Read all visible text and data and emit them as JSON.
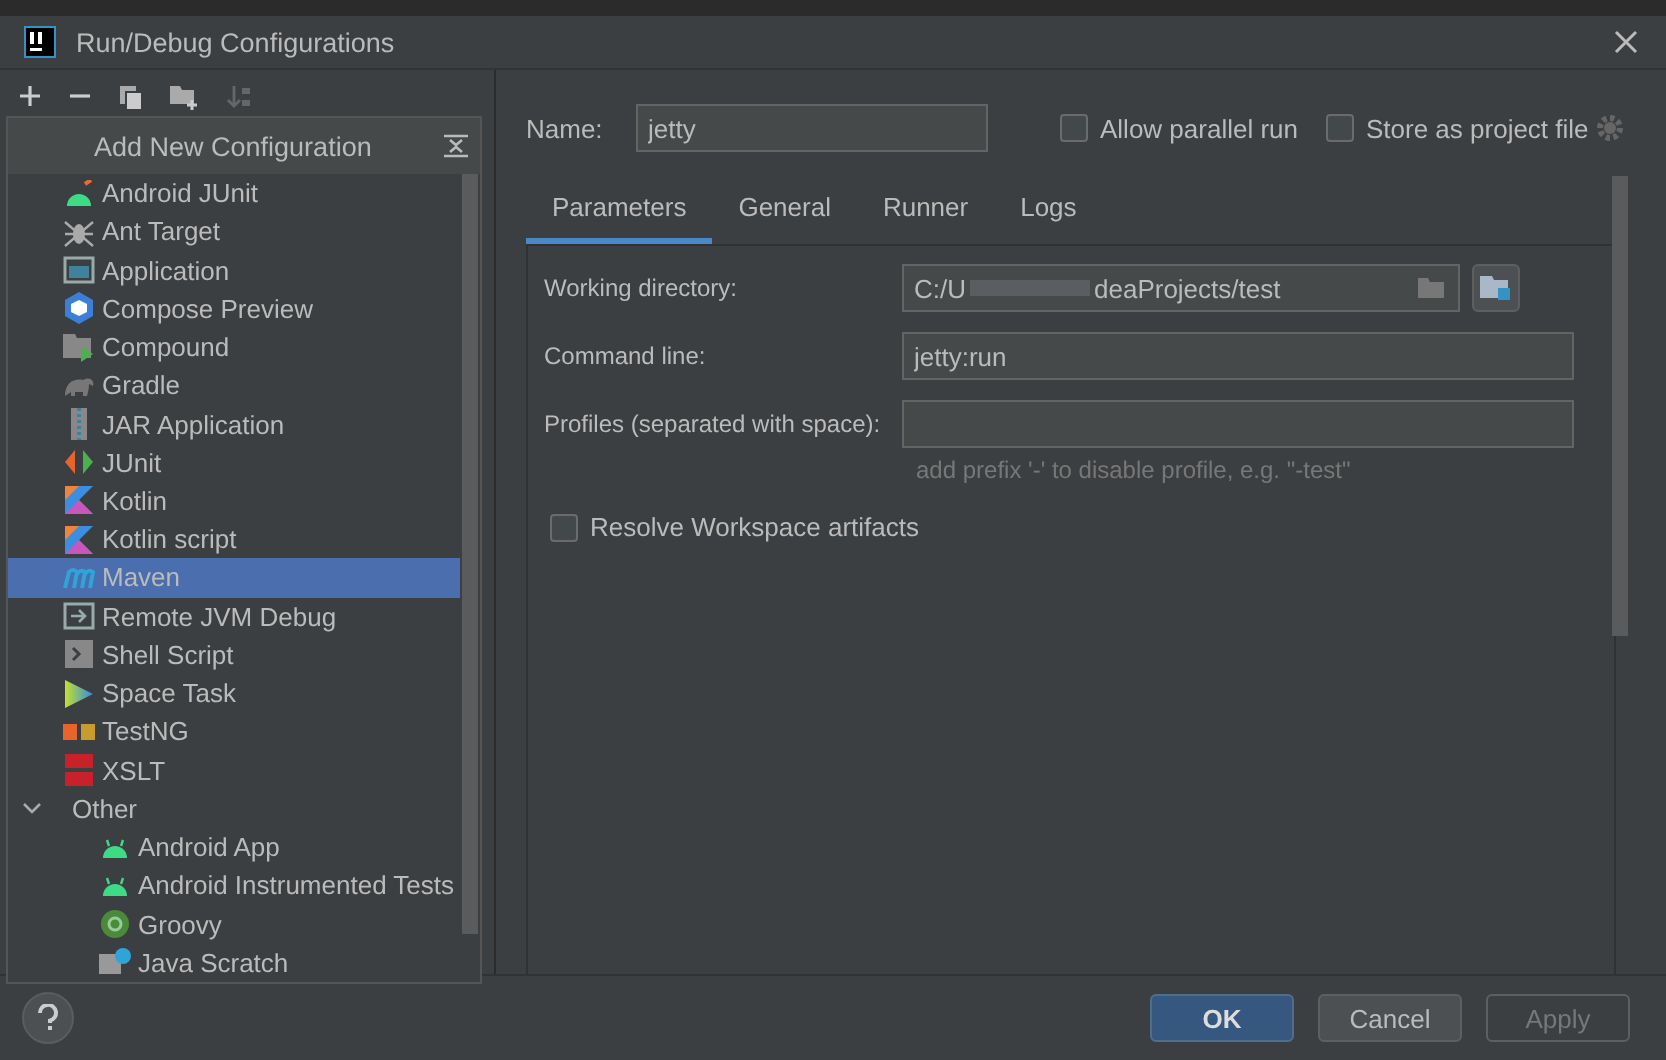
{
  "window": {
    "title": "Run/Debug Configurations"
  },
  "popup": {
    "title": "Add New Configuration",
    "items": [
      {
        "label": "Android JUnit",
        "selected": false
      },
      {
        "label": "Ant Target",
        "selected": false
      },
      {
        "label": "Application",
        "selected": false
      },
      {
        "label": "Compose Preview",
        "selected": false
      },
      {
        "label": "Compound",
        "selected": false
      },
      {
        "label": "Gradle",
        "selected": false
      },
      {
        "label": "JAR Application",
        "selected": false
      },
      {
        "label": "JUnit",
        "selected": false
      },
      {
        "label": "Kotlin",
        "selected": false
      },
      {
        "label": "Kotlin script",
        "selected": false
      },
      {
        "label": "Maven",
        "selected": true
      },
      {
        "label": "Remote JVM Debug",
        "selected": false
      },
      {
        "label": "Shell Script",
        "selected": false
      },
      {
        "label": "Space Task",
        "selected": false
      },
      {
        "label": "TestNG",
        "selected": false
      },
      {
        "label": "XSLT",
        "selected": false
      },
      {
        "label": "Other",
        "selected": false,
        "expanded": true,
        "children": [
          {
            "label": "Android App",
            "selected": false
          },
          {
            "label": "Android Instrumented Tests",
            "selected": false
          },
          {
            "label": "Groovy",
            "selected": false
          },
          {
            "label": "Java Scratch",
            "selected": false
          }
        ]
      }
    ]
  },
  "config": {
    "name_label": "Name:",
    "name": "jetty",
    "options": [
      {
        "label": "Allow parallel run",
        "checked": false
      },
      {
        "label": "Store as project file",
        "checked": false
      }
    ],
    "tabs": [
      {
        "label": "Parameters",
        "selected": true
      },
      {
        "label": "General",
        "selected": false
      },
      {
        "label": "Runner",
        "selected": false
      },
      {
        "label": "Logs",
        "selected": false
      }
    ],
    "working_directory": {
      "label": "Working directory:",
      "value_start": "C:/U",
      "value_end": "deaProjects/test"
    },
    "command_line": {
      "label": "Command line:",
      "value": "jetty:run"
    },
    "profiles": {
      "label": "Profiles (separated with space):",
      "hint": "add prefix '-' to disable profile, e.g. \"-test\""
    },
    "resolve": {
      "label": "Resolve Workspace artifacts",
      "checked": false
    }
  },
  "buttons": [
    {
      "label": "OK",
      "kind": "primary"
    },
    {
      "label": "Cancel",
      "kind": "normal"
    },
    {
      "label": "Apply",
      "kind": "disabled"
    }
  ]
}
